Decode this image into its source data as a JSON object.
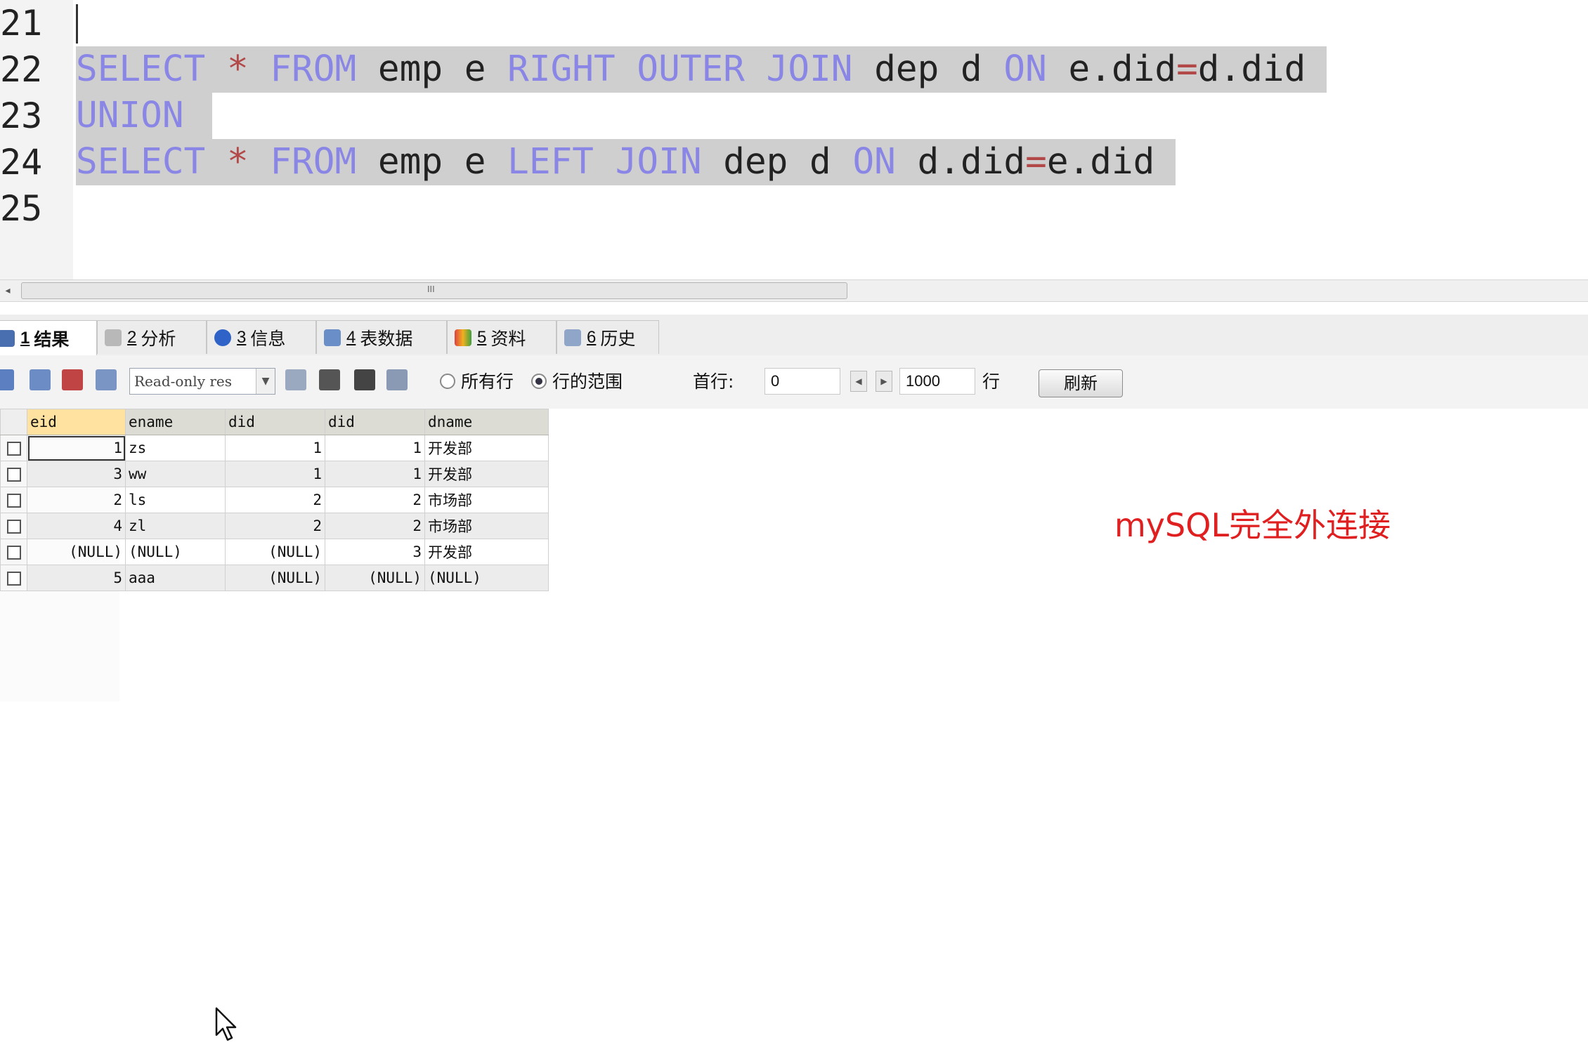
{
  "editor": {
    "lines": [
      {
        "num": "21",
        "tokens": []
      },
      {
        "num": "22",
        "tokens": [
          {
            "t": "SELECT",
            "c": "kw"
          },
          {
            "t": " ",
            "c": ""
          },
          {
            "t": "*",
            "c": "op"
          },
          {
            "t": " ",
            "c": ""
          },
          {
            "t": "FROM",
            "c": "kw"
          },
          {
            "t": " emp e ",
            "c": ""
          },
          {
            "t": "RIGHT",
            "c": "kw"
          },
          {
            "t": " ",
            "c": ""
          },
          {
            "t": "OUTER",
            "c": "kw"
          },
          {
            "t": " ",
            "c": ""
          },
          {
            "t": "JOIN",
            "c": "kw"
          },
          {
            "t": " dep d ",
            "c": ""
          },
          {
            "t": "ON",
            "c": "kw"
          },
          {
            "t": " e.did",
            "c": ""
          },
          {
            "t": "=",
            "c": "op"
          },
          {
            "t": "d.did",
            "c": ""
          }
        ]
      },
      {
        "num": "23",
        "tokens": [
          {
            "t": "UNION",
            "c": "kw"
          }
        ]
      },
      {
        "num": "24",
        "tokens": [
          {
            "t": "SELECT",
            "c": "kw"
          },
          {
            "t": " ",
            "c": ""
          },
          {
            "t": "*",
            "c": "op"
          },
          {
            "t": " ",
            "c": ""
          },
          {
            "t": "FROM",
            "c": "kw"
          },
          {
            "t": " emp e ",
            "c": ""
          },
          {
            "t": "LEFT",
            "c": "kw"
          },
          {
            "t": " ",
            "c": ""
          },
          {
            "t": "JOIN",
            "c": "kw"
          },
          {
            "t": " dep d ",
            "c": ""
          },
          {
            "t": "ON",
            "c": "kw"
          },
          {
            "t": " d.did",
            "c": ""
          },
          {
            "t": "=",
            "c": "op"
          },
          {
            "t": "e.did",
            "c": ""
          }
        ]
      },
      {
        "num": "25",
        "tokens": []
      }
    ]
  },
  "scrollbar": {
    "grip": "III",
    "left_arrow": "◂"
  },
  "tabs": [
    {
      "num": "1",
      "label": "结果",
      "icon": "result-icon",
      "active": true
    },
    {
      "num": "2",
      "label": "分析",
      "icon": "analyze-icon",
      "active": false
    },
    {
      "num": "3",
      "label": "信息",
      "icon": "info-icon",
      "active": false
    },
    {
      "num": "4",
      "label": "表数据",
      "icon": "table-data-icon",
      "active": false
    },
    {
      "num": "5",
      "label": "资料",
      "icon": "profile-icon",
      "active": false
    },
    {
      "num": "6",
      "label": "历史",
      "icon": "history-icon",
      "active": false
    }
  ],
  "toolbar": {
    "mode_value": "Read-only res",
    "radio_all_rows": "所有行",
    "radio_row_range": "行的范围",
    "first_row_label": "首行:",
    "first_row_value": "0",
    "row_count_value": "1000",
    "rows_suffix": "行",
    "refresh_label": "刷新"
  },
  "grid": {
    "columns": [
      "eid",
      "ename",
      "did",
      "did",
      "dname"
    ],
    "rows": [
      [
        "1",
        "zs",
        "1",
        "1",
        "开发部"
      ],
      [
        "3",
        "ww",
        "1",
        "1",
        "开发部"
      ],
      [
        "2",
        "ls",
        "2",
        "2",
        "市场部"
      ],
      [
        "4",
        "zl",
        "2",
        "2",
        "市场部"
      ],
      [
        "(NULL)",
        "(NULL)",
        "(NULL)",
        "3",
        "开发部"
      ],
      [
        "5",
        "aaa",
        "(NULL)",
        "(NULL)",
        "(NULL)"
      ]
    ]
  },
  "annotation": "mySQL完全外连接",
  "colors": {
    "keyword": "#8a86e6",
    "operator": "#b24848",
    "selection": "#cfcfcf",
    "annotation": "#e02020"
  }
}
